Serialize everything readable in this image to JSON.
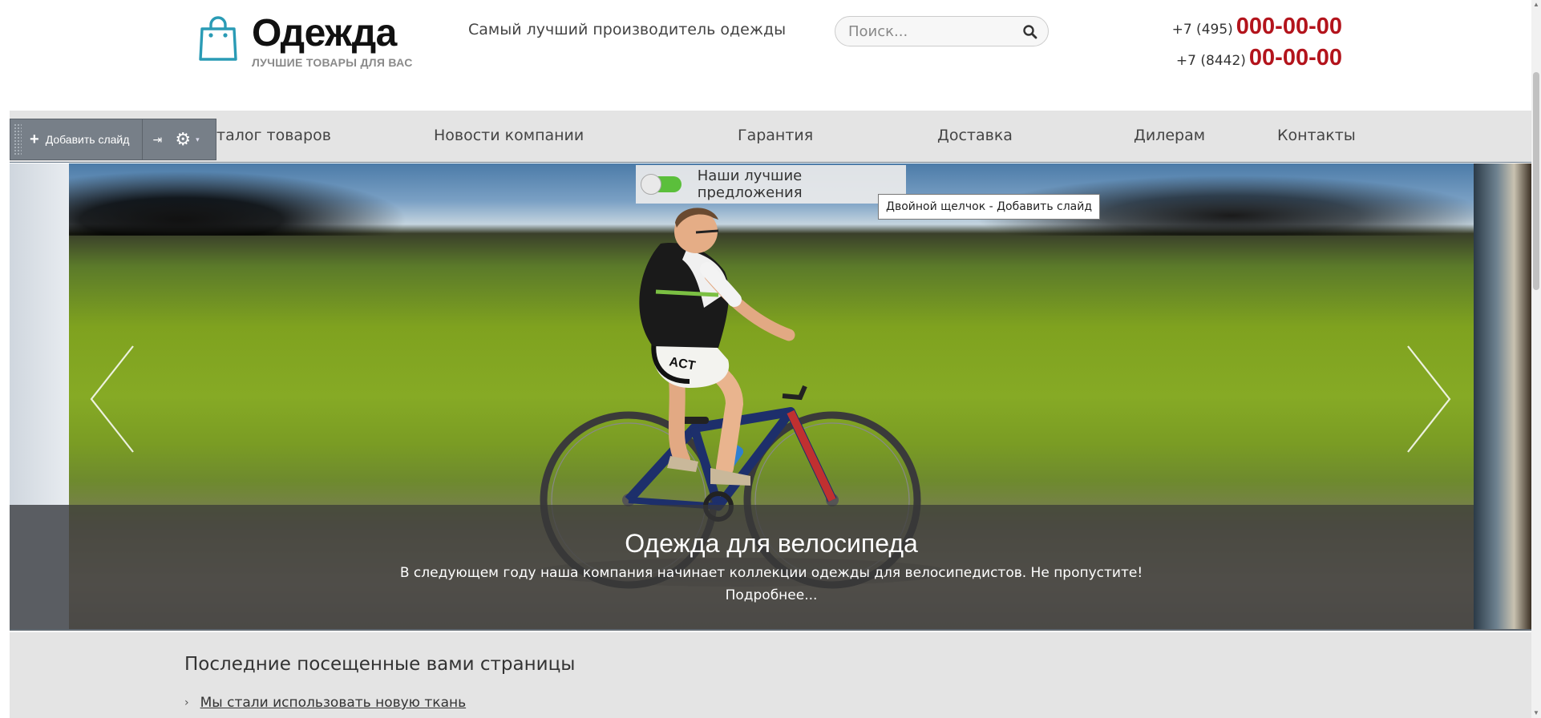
{
  "header": {
    "logo_title": "Одежда",
    "logo_subtitle": "ЛУЧШИЕ ТОВАРЫ ДЛЯ ВАС",
    "tagline": "Самый лучший производитель одежды",
    "search_placeholder": "Поиск...",
    "phones": [
      {
        "code": "+7 (495)",
        "number": "000-00-00"
      },
      {
        "code": "+7 (8442)",
        "number": "00-00-00"
      }
    ]
  },
  "nav": {
    "items": [
      {
        "label": "Каталог товаров",
        "visible_text": "талог товаров"
      },
      {
        "label": "Новости компании"
      },
      {
        "label": "Гарантия"
      },
      {
        "label": "Доставка"
      },
      {
        "label": "Дилерам"
      },
      {
        "label": "Контакты"
      }
    ]
  },
  "toolbar": {
    "add_slide_label": "Добавить слайд",
    "pin_symbol": "⇥",
    "gear_symbol": "⚙",
    "caret_symbol": "▾"
  },
  "slider": {
    "toggle_label": "Наши лучшие предложения",
    "tooltip": "Двойной щелчок - Добавить слайд",
    "caption_title": "Одежда для велосипеда",
    "caption_text": "В следующем году наша компания начинает коллекции одежды для велосипедистов. Не пропустите!",
    "caption_more": "Подробнее..."
  },
  "recent": {
    "title": "Последние посещенные вами страницы",
    "items": [
      "Мы стали использовать новую ткань"
    ],
    "chevron": "›"
  },
  "colors": {
    "accent_red": "#b3141c",
    "logo_teal": "#2a9bb5",
    "nav_bg": "#e4e4e4",
    "toolbar_bg": "#777f88",
    "toggle_green": "#5bbf3b"
  },
  "icons": [
    "shopping-bag-icon",
    "search-icon",
    "plus-icon",
    "pin-icon",
    "gear-icon",
    "chevron-left-icon",
    "chevron-right-icon",
    "chevron-right-small-icon"
  ]
}
